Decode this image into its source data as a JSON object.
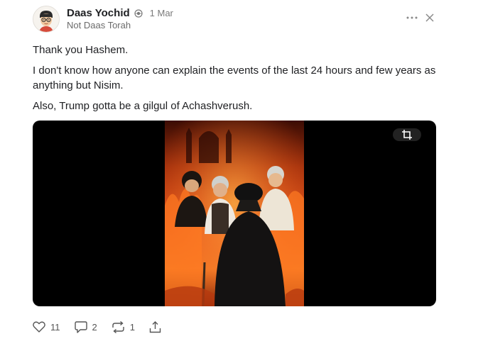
{
  "author": {
    "name": "Daas Yochid",
    "subtitle": "Not Daas Torah",
    "date": "1 Mar",
    "avatar_icon": "cartoon-avatar-icon",
    "badge_icon": "globe-badge-icon"
  },
  "post": {
    "paragraphs": [
      "Thank you Hashem.",
      "I don't know how anyone can explain the events of the last 24 hours and few years as anything but Nisim.",
      "Also, Trump gotta be a gilgul of Achashverush."
    ]
  },
  "media": {
    "crop_icon": "crop-icon"
  },
  "actions": {
    "likes": "11",
    "comments": "2",
    "reposts": "1",
    "like_icon": "heart-icon",
    "comment_icon": "comment-icon",
    "repost_icon": "repost-icon",
    "share_icon": "share-icon"
  },
  "header_controls": {
    "more_icon": "more-icon",
    "close_icon": "close-icon"
  },
  "colors": {
    "text": "#202124",
    "muted": "#7a7a7a",
    "media_bg": "#000000",
    "fire": "#e8541a"
  }
}
